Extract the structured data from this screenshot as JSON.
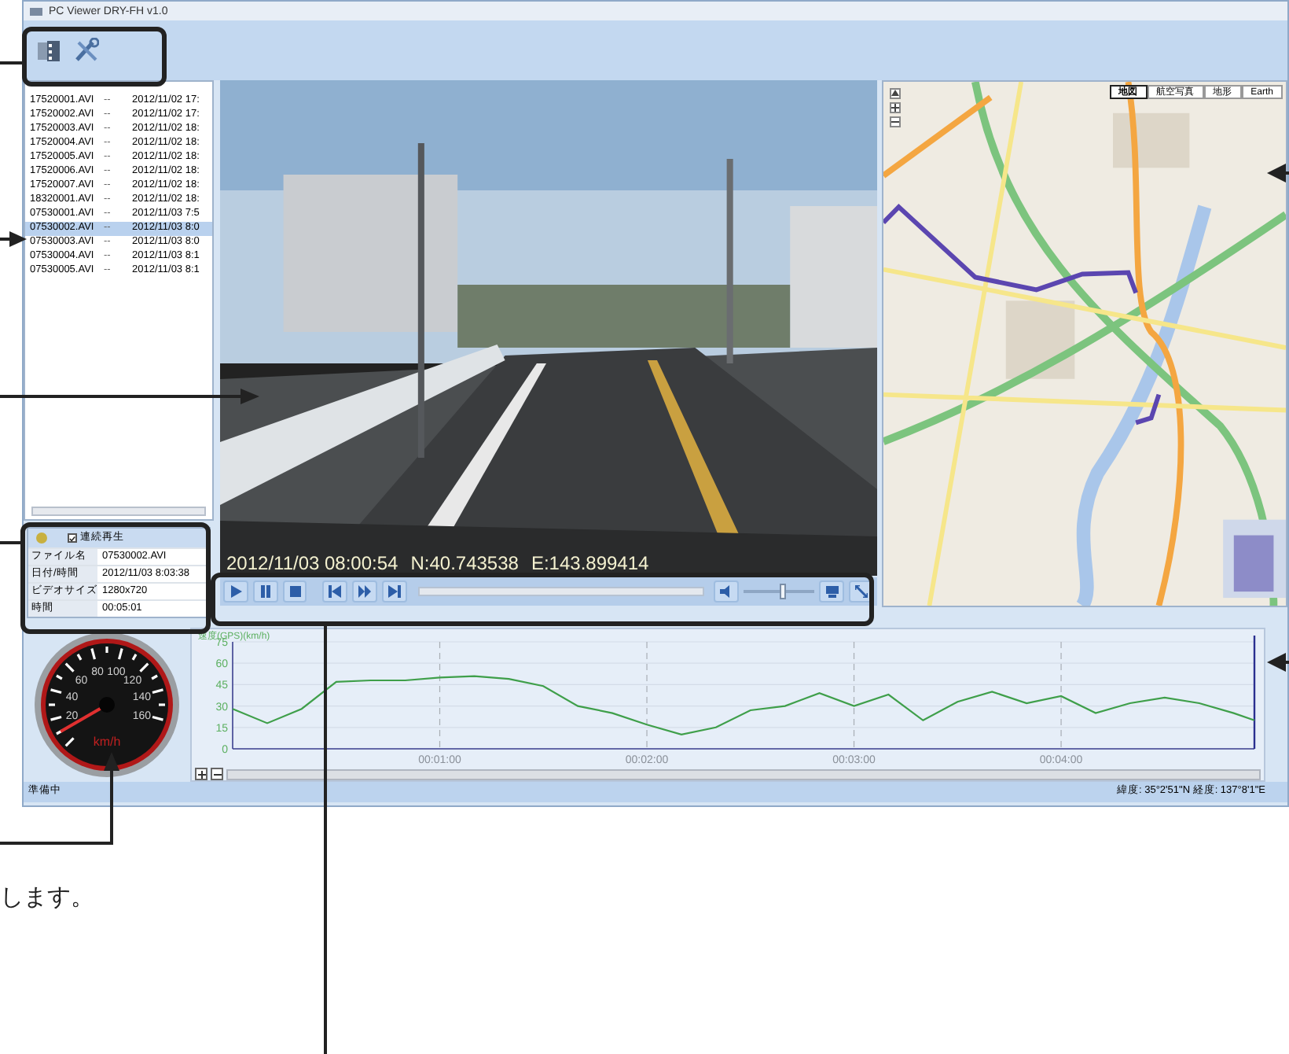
{
  "window": {
    "title": "PC Viewer DRY-FH v1.0"
  },
  "file_list": {
    "rows": [
      {
        "name": "17520001.AVI",
        "column_2": "--",
        "date": "2012/11/02 17:",
        "selected": false
      },
      {
        "name": "17520002.AVI",
        "column_2": "--",
        "date": "2012/11/02 17:",
        "selected": false
      },
      {
        "name": "17520003.AVI",
        "column_2": "--",
        "date": "2012/11/02 18:",
        "selected": false
      },
      {
        "name": "17520004.AVI",
        "column_2": "--",
        "date": "2012/11/02 18:",
        "selected": false
      },
      {
        "name": "17520005.AVI",
        "column_2": "--",
        "date": "2012/11/02 18:",
        "selected": false
      },
      {
        "name": "17520006.AVI",
        "column_2": "--",
        "date": "2012/11/02 18:",
        "selected": false
      },
      {
        "name": "17520007.AVI",
        "column_2": "--",
        "date": "2012/11/02 18:",
        "selected": false
      },
      {
        "name": "18320001.AVI",
        "column_2": "--",
        "date": "2012/11/02 18:",
        "selected": false
      },
      {
        "name": "07530001.AVI",
        "column_2": "--",
        "date": "2012/11/03 7:5",
        "selected": false
      },
      {
        "name": "07530002.AVI",
        "column_2": "--",
        "date": "2012/11/03 8:0",
        "selected": true
      },
      {
        "name": "07530003.AVI",
        "column_2": "--",
        "date": "2012/11/03 8:0",
        "selected": false
      },
      {
        "name": "07530004.AVI",
        "column_2": "--",
        "date": "2012/11/03 8:1",
        "selected": false
      },
      {
        "name": "07530005.AVI",
        "column_2": "--",
        "date": "2012/11/03 8:1",
        "selected": false
      }
    ]
  },
  "info_panel": {
    "continuous_play": {
      "label": "連続再生",
      "checked": true
    },
    "rows": [
      {
        "label": "ファイル名",
        "value": "07530002.AVI"
      },
      {
        "label": "日付/時間",
        "value": "2012/11/03 8:03:38"
      },
      {
        "label": "ビデオサイズ",
        "value": "1280x720"
      },
      {
        "label": "時間",
        "value": "00:05:01"
      }
    ]
  },
  "speedometer": {
    "labels": [
      "20",
      "40",
      "60",
      "80",
      "100",
      "120",
      "140",
      "160"
    ],
    "unit": "km/h"
  },
  "video": {
    "kind": "picture",
    "overlay": [
      "2012/11/03 08:00:54",
      "N:40.743538",
      "E:143.899414"
    ]
  },
  "controls": {
    "volume": {
      "level": 0.55
    }
  },
  "map": {
    "kind": "picture",
    "map_types": [
      {
        "label": "地図",
        "selected": true
      },
      {
        "label": "航空写真",
        "selected": false
      },
      {
        "label": "地形",
        "selected": false
      },
      {
        "label": "Earth",
        "selected": false
      }
    ]
  },
  "chart": {
    "chart_data": {
      "type": "line",
      "ylabel": "速度(GPS)(km/h)",
      "x": [
        0,
        10,
        20,
        30,
        40,
        50,
        60,
        70,
        80,
        90,
        100,
        110,
        120,
        130,
        140,
        150,
        160,
        170,
        180,
        190,
        200,
        210,
        220,
        230,
        240,
        250,
        260,
        270,
        280,
        290,
        296
      ],
      "series": [
        {
          "color": "#3f9f4a",
          "values": [
            28,
            18,
            28,
            47,
            48,
            48,
            50,
            51,
            49,
            44,
            30,
            25,
            17,
            10,
            15,
            27,
            30,
            39,
            30,
            38,
            20,
            33,
            40,
            32,
            37,
            25,
            32,
            36,
            32,
            25,
            20
          ]
        }
      ],
      "grid": true,
      "xlim": [
        0,
        296
      ],
      "ylim": [
        0,
        75
      ],
      "yticks": [
        0,
        15,
        30,
        45,
        60,
        75
      ],
      "xticks": [
        {
          "value": 60,
          "label": "00:01:00"
        },
        {
          "value": 120,
          "label": "00:02:00"
        },
        {
          "value": 180,
          "label": "00:03:00"
        },
        {
          "value": 240,
          "label": "00:04:00"
        }
      ]
    }
  },
  "status_bar": {
    "left": "準備中",
    "right": "緯度: 35°2'51\"N  経度: 137°8'1\"E"
  },
  "caption": "します。"
}
